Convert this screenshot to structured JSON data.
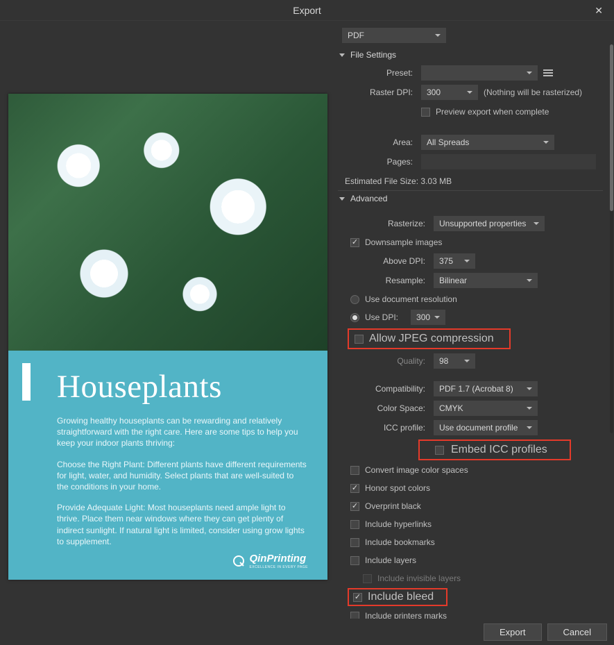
{
  "title": "Export",
  "previewDoc": {
    "heading": "Houseplants",
    "p1": "Growing healthy houseplants can be rewarding and relatively straightforward with the right care. Here are some tips to help you keep your indoor plants thriving:",
    "p2": "Choose the Right Plant: Different plants have different requirements for light, water, and humidity. Select plants that are well-suited to the conditions in your home.",
    "p3": "Provide Adequate Light: Most houseplants need ample light to thrive. Place them near windows where they can get plenty of indirect sunlight. If natural light is limited, consider using grow lights to supplement.",
    "brand": "QinPrinting",
    "brandSub": "EXCELLENCE IN EVERY PAGE"
  },
  "format": {
    "value": "PDF"
  },
  "fileSettings": {
    "head": "File Settings",
    "presetLabel": "Preset:",
    "presetValue": "",
    "rasterDpiLabel": "Raster DPI:",
    "rasterDpiValue": "300",
    "rasterHint": "(Nothing will be rasterized)",
    "previewExportLabel": "Preview export when complete",
    "areaLabel": "Area:",
    "areaValue": "All Spreads",
    "pagesLabel": "Pages:",
    "pagesValue": "",
    "estLabel": "Estimated File Size:",
    "estValue": "3.03 MB"
  },
  "advanced": {
    "head": "Advanced",
    "rasterizeLabel": "Rasterize:",
    "rasterizeValue": "Unsupported properties",
    "downsampleLabel": "Downsample images",
    "aboveDpiLabel": "Above DPI:",
    "aboveDpiValue": "375",
    "resampleLabel": "Resample:",
    "resampleValue": "Bilinear",
    "useDocResLabel": "Use document resolution",
    "useDpiLabel": "Use DPI:",
    "useDpiValue": "300",
    "allowJpegLabel": "Allow JPEG compression",
    "qualityLabel": "Quality:",
    "qualityValue": "98",
    "compatLabel": "Compatibility:",
    "compatValue": "PDF 1.7 (Acrobat 8)",
    "colorSpaceLabel": "Color Space:",
    "colorSpaceValue": "CMYK",
    "iccProfileLabel": "ICC profile:",
    "iccProfileValue": "Use document profile",
    "embedIccLabel": "Embed ICC profiles",
    "convertSpacesLabel": "Convert image color spaces",
    "honorSpotLabel": "Honor spot colors",
    "overprintBlackLabel": "Overprint black",
    "includeHyperlinksLabel": "Include hyperlinks",
    "includeBookmarksLabel": "Include bookmarks",
    "includeLayersLabel": "Include layers",
    "includeInvisibleLabel": "Include invisible layers",
    "includeBleedLabel": "Include bleed",
    "includePrintersLabel": "Include printers marks"
  },
  "footer": {
    "export": "Export",
    "cancel": "Cancel"
  }
}
